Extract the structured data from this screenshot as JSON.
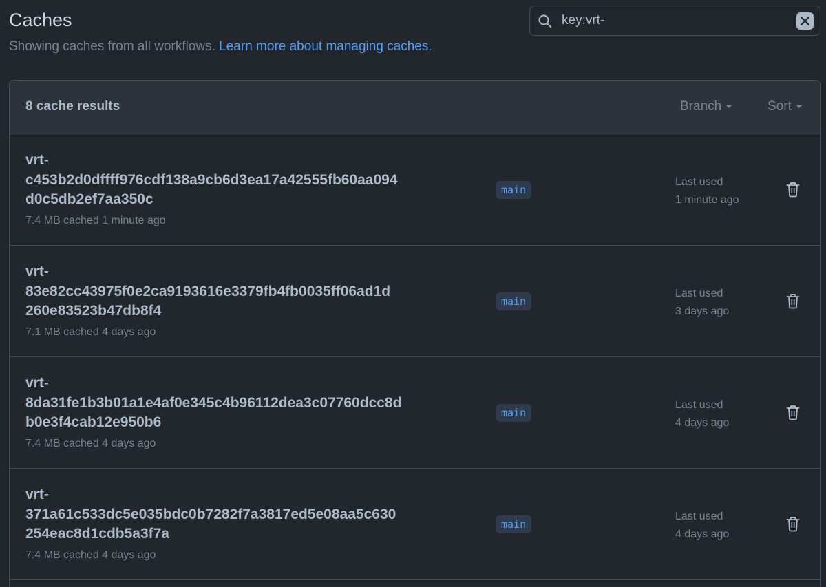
{
  "header": {
    "title": "Caches",
    "subtitle": "Showing caches from all workflows. ",
    "learn_more_link": "Learn more about managing caches."
  },
  "search": {
    "value": "key:vrt-",
    "icon": "search-icon",
    "clear_icon": "x-icon"
  },
  "results": {
    "count_label": "8 cache results",
    "branch_filter_label": "Branch",
    "sort_label": "Sort"
  },
  "caches": [
    {
      "key_line1": "vrt-",
      "key_line2": "c453b2d0dffff976cdf138a9cb6d3ea17a42555fb60aa094",
      "key_line3": "d0c5db2ef7aa350c",
      "meta": "7.4 MB cached 1 minute ago",
      "branch": "main",
      "last_used_label": "Last used",
      "last_used_value": "1 minute ago"
    },
    {
      "key_line1": "vrt-",
      "key_line2": "83e82cc43975f0e2ca9193616e3379fb4fb0035ff06ad1d",
      "key_line3": "260e83523b47db8f4",
      "meta": "7.1 MB cached 4 days ago",
      "branch": "main",
      "last_used_label": "Last used",
      "last_used_value": "3 days ago"
    },
    {
      "key_line1": "vrt-",
      "key_line2": "8da31fe1b3b01a1e4af0e345c4b96112dea3c07760dcc8d",
      "key_line3": "b0e3f4cab12e950b6",
      "meta": "7.4 MB cached 4 days ago",
      "branch": "main",
      "last_used_label": "Last used",
      "last_used_value": "4 days ago"
    },
    {
      "key_line1": "vrt-",
      "key_line2": "371a61c533dc5e035bdc0b7282f7a3817ed5e08aa5c630",
      "key_line3": "254eac8d1cdb5a3f7a",
      "meta": "7.4 MB cached 4 days ago",
      "branch": "main",
      "last_used_label": "Last used",
      "last_used_value": "4 days ago"
    }
  ],
  "colors": {
    "background": "#22272e",
    "header_bg": "#2d333b",
    "border": "#444c56",
    "link": "#539bf5",
    "muted": "#768390"
  }
}
